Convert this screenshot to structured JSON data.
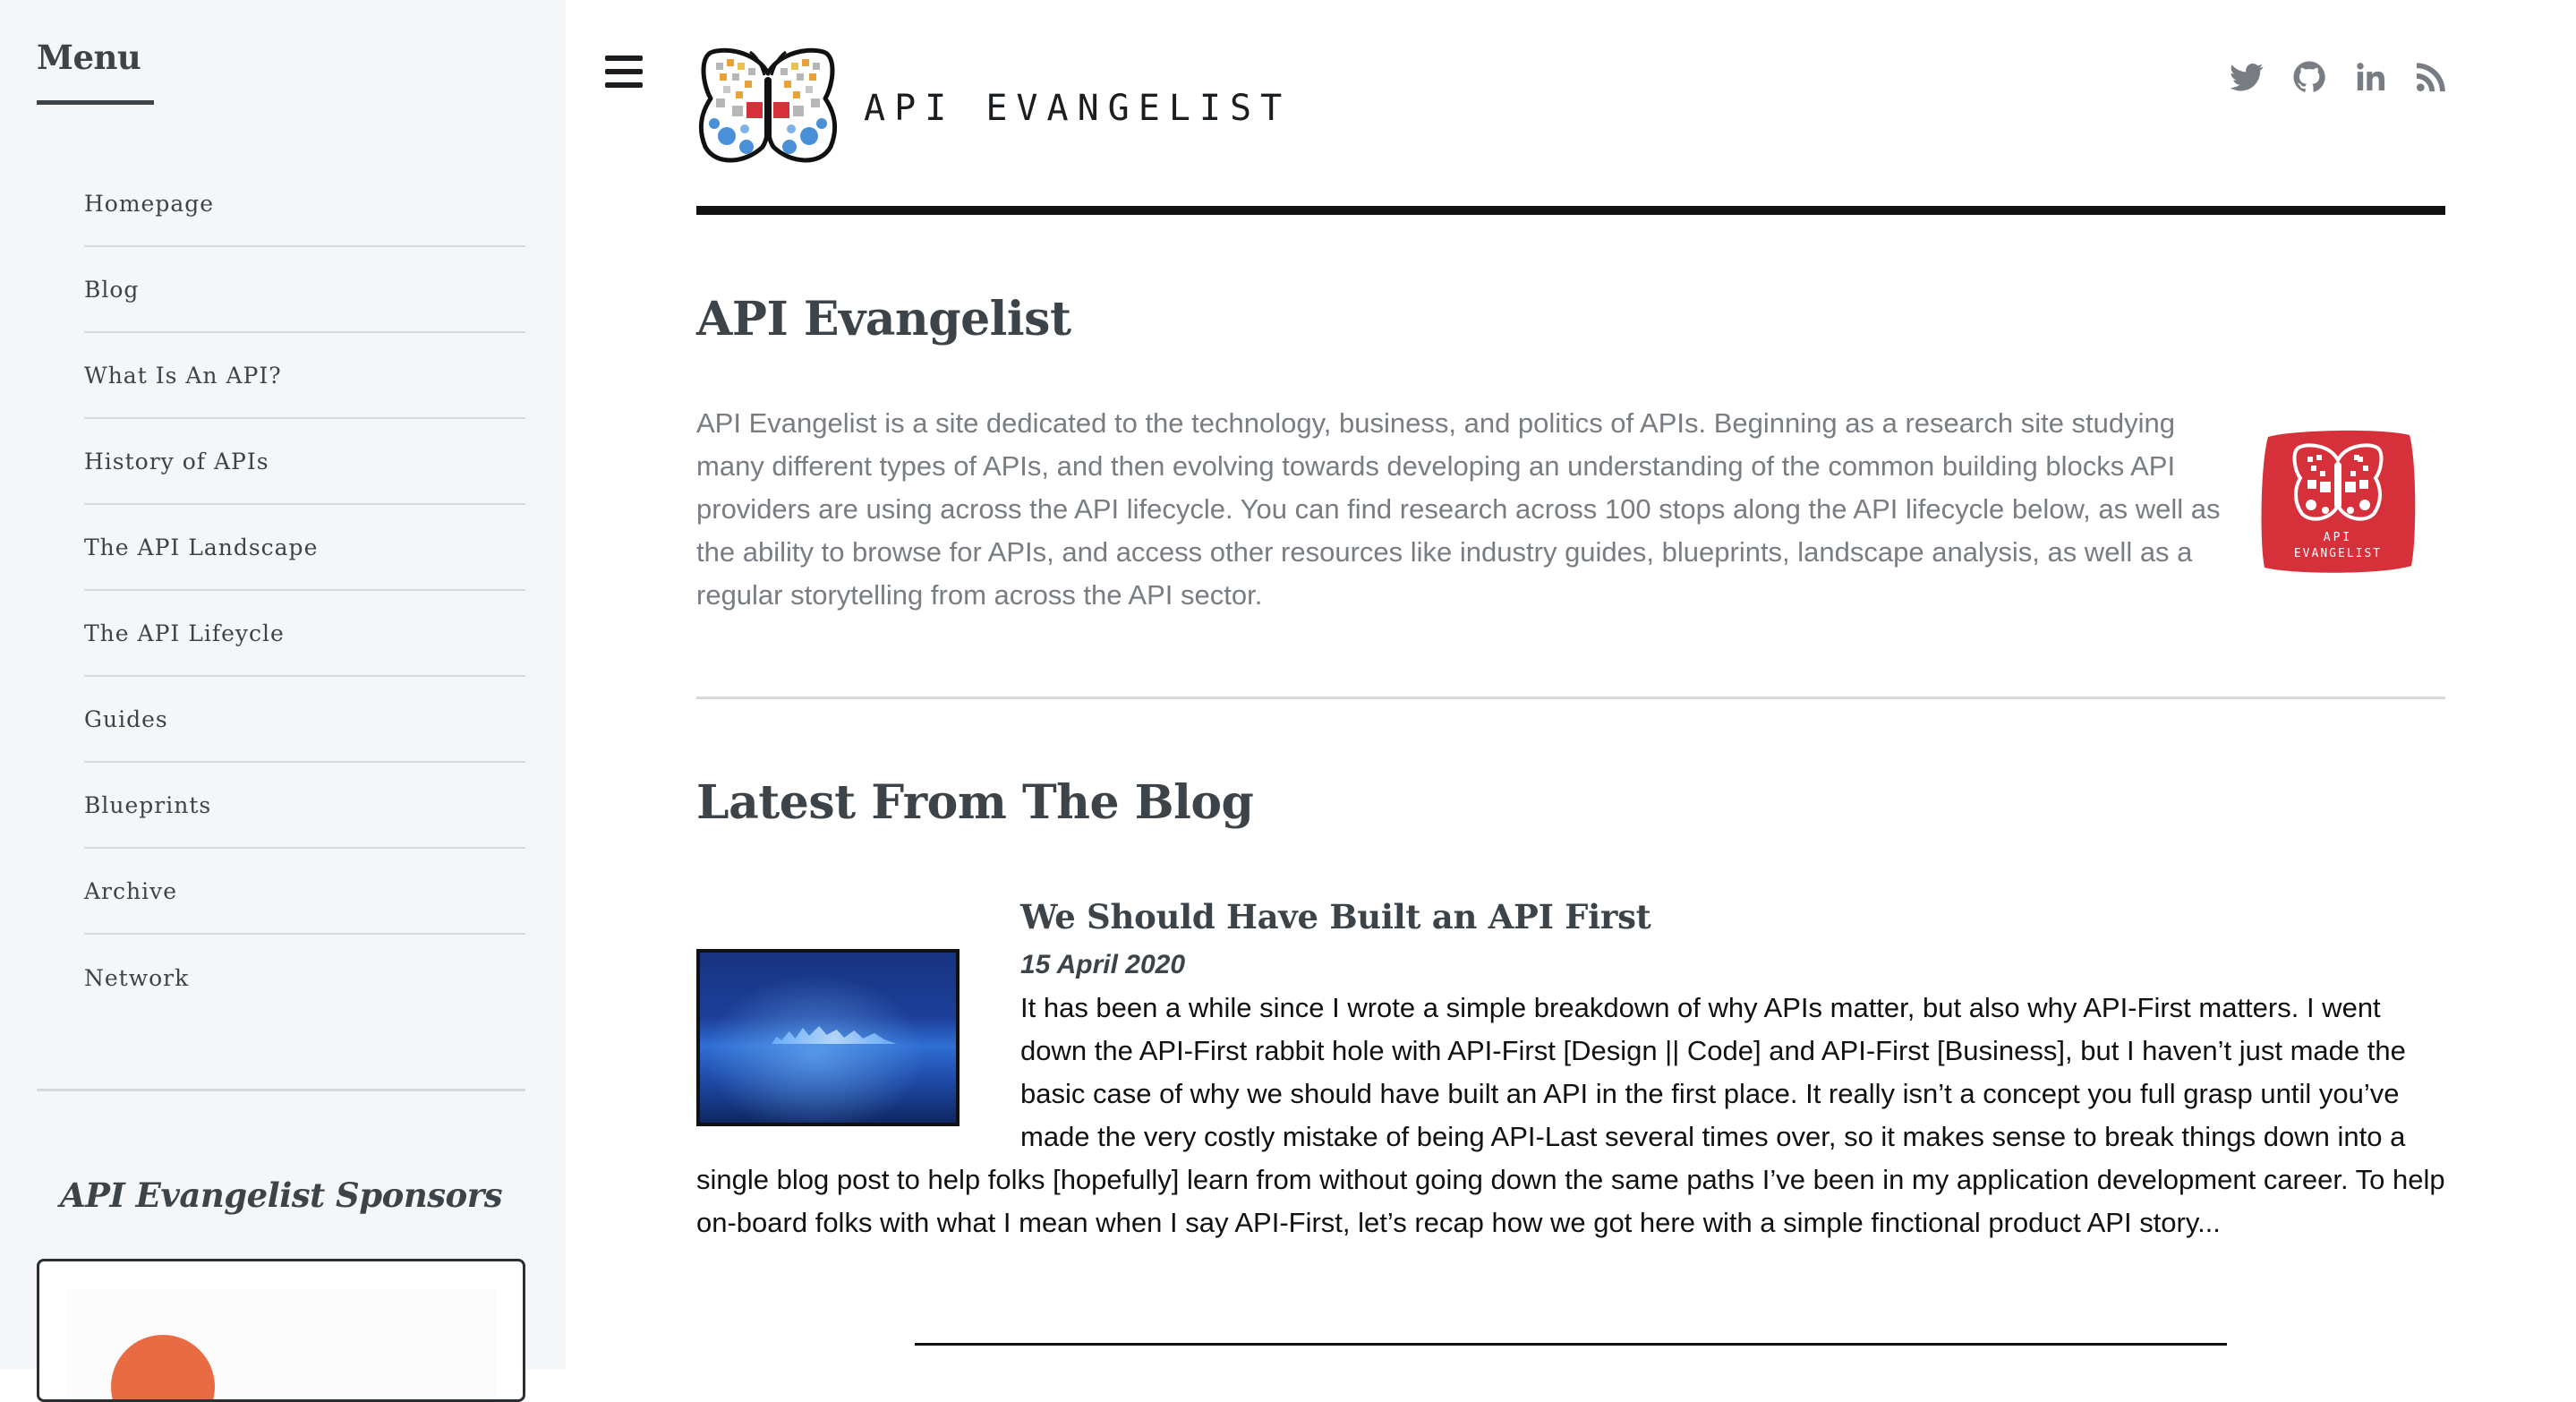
{
  "sidebar": {
    "menu_title": "Menu",
    "nav_items": [
      {
        "label": "Homepage"
      },
      {
        "label": "Blog"
      },
      {
        "label": "What Is An API?"
      },
      {
        "label": "History of APIs"
      },
      {
        "label": "The API Landscape"
      },
      {
        "label": "The API Lifeycle"
      },
      {
        "label": "Guides"
      },
      {
        "label": "Blueprints"
      },
      {
        "label": "Archive"
      },
      {
        "label": "Network"
      }
    ],
    "sponsors_title": "API Evangelist Sponsors"
  },
  "header": {
    "menu_icon": "hamburger-menu-icon",
    "brand": "API EVANGELIST",
    "social_icons": [
      "twitter-icon",
      "github-icon",
      "linkedin-icon",
      "rss-icon"
    ]
  },
  "intro": {
    "title": "API Evangelist",
    "text": "API Evangelist is a site dedicated to the technology, business, and politics of APIs. Beginning as a research site studying many different types of APIs, and then evolving towards developing an understanding of the common building blocks API providers are using across the API lifecycle. You can find research across 100 stops along the API lifecycle below, as well as the ability to browse for APIs, and access other resources like industry guides, blueprints, landscape analysis, as well as a regular storytelling from across the API sector.",
    "badge_text": "API EVANGELIST"
  },
  "blog": {
    "section_title": "Latest From The Blog",
    "posts": [
      {
        "title": "We Should Have Built an API First",
        "date": "15 April 2020",
        "excerpt": "It has been a while since I wrote a simple breakdown of why APIs matter, but also why API-First matters. I went down the API-First rabbit hole with API-First [Design || Code] and API-First [Business], but I haven’t just made the basic case of why we should have built an API in the first place. It really isn’t a concept you full grasp until you’ve made the very costly mistake of being API-Last several times over, so it makes sense to break things down into a single blog post to help folks [hopefully] learn from without going down the same paths I’ve been in my application development career. To help on-board folks with what I mean when I say API-First, let’s recap how we got here with a simple finctional product API story..."
      }
    ]
  },
  "colors": {
    "sidebar_bg": "#f5f6f7",
    "text_dark": "#3d4449",
    "text_muted": "#777d83",
    "badge_red": "#d6303a",
    "logo_blue": "#4a90d9",
    "logo_orange": "#e8a23c"
  }
}
